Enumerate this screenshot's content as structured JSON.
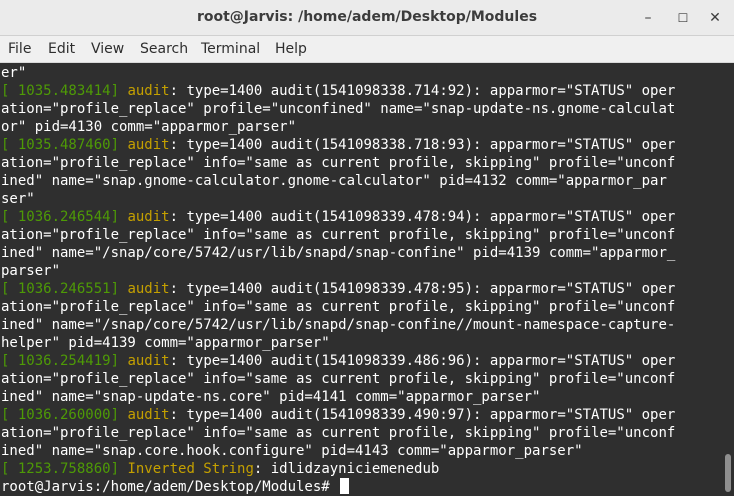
{
  "window": {
    "title": "root@Jarvis: /home/adem/Desktop/Modules",
    "controls": {
      "minimize": "–",
      "maximize": "☐",
      "close": "✕"
    }
  },
  "menu": [
    "File",
    "Edit",
    "View",
    "Search",
    "Terminal",
    "Help"
  ],
  "terminal": {
    "lines": [
      {
        "text": "er\""
      },
      {
        "ts": "[ 1035.483414]",
        "kw": "audit",
        "rest": ": type=1400 audit(1541098338.714:92): apparmor=\"STATUS\" oper"
      },
      {
        "text": "ation=\"profile_replace\" profile=\"unconfined\" name=\"snap-update-ns.gnome-calculat"
      },
      {
        "text": "or\" pid=4130 comm=\"apparmor_parser\""
      },
      {
        "ts": "[ 1035.487460]",
        "kw": "audit",
        "rest": ": type=1400 audit(1541098338.718:93): apparmor=\"STATUS\" oper"
      },
      {
        "text": "ation=\"profile_replace\" info=\"same as current profile, skipping\" profile=\"unconf"
      },
      {
        "text": "ined\" name=\"snap.gnome-calculator.gnome-calculator\" pid=4132 comm=\"apparmor_par"
      },
      {
        "text": "ser\""
      },
      {
        "ts": "[ 1036.246544]",
        "kw": "audit",
        "rest": ": type=1400 audit(1541098339.478:94): apparmor=\"STATUS\" oper"
      },
      {
        "text": "ation=\"profile_replace\" info=\"same as current profile, skipping\" profile=\"unconf"
      },
      {
        "text": "ined\" name=\"/snap/core/5742/usr/lib/snapd/snap-confine\" pid=4139 comm=\"apparmor_"
      },
      {
        "text": "parser\""
      },
      {
        "ts": "[ 1036.246551]",
        "kw": "audit",
        "rest": ": type=1400 audit(1541098339.478:95): apparmor=\"STATUS\" oper"
      },
      {
        "text": "ation=\"profile_replace\" info=\"same as current profile, skipping\" profile=\"unconf"
      },
      {
        "text": "ined\" name=\"/snap/core/5742/usr/lib/snapd/snap-confine//mount-namespace-capture-"
      },
      {
        "text": "helper\" pid=4139 comm=\"apparmor_parser\""
      },
      {
        "ts": "[ 1036.254419]",
        "kw": "audit",
        "rest": ": type=1400 audit(1541098339.486:96): apparmor=\"STATUS\" oper"
      },
      {
        "text": "ation=\"profile_replace\" info=\"same as current profile, skipping\" profile=\"unconf"
      },
      {
        "text": "ined\" name=\"snap-update-ns.core\" pid=4141 comm=\"apparmor_parser\""
      },
      {
        "ts": "[ 1036.260000]",
        "kw": "audit",
        "rest": ": type=1400 audit(1541098339.490:97): apparmor=\"STATUS\" oper"
      },
      {
        "text": "ation=\"profile_replace\" info=\"same as current profile, skipping\" profile=\"unconf"
      },
      {
        "text": "ined\" name=\"snap.core.hook.configure\" pid=4143 comm=\"apparmor_parser\""
      },
      {
        "ts": "[ 1253.758860]",
        "kw": "Inverted String",
        "rest": ": idlidzayniciemenedub"
      }
    ],
    "prompt": "root@Jarvis:/home/adem/Desktop/Modules# "
  },
  "colors": {
    "timestamp": "#4e9a06",
    "keyword": "#c4a000",
    "text": "#ffffff",
    "background": "#2f2f2f"
  }
}
